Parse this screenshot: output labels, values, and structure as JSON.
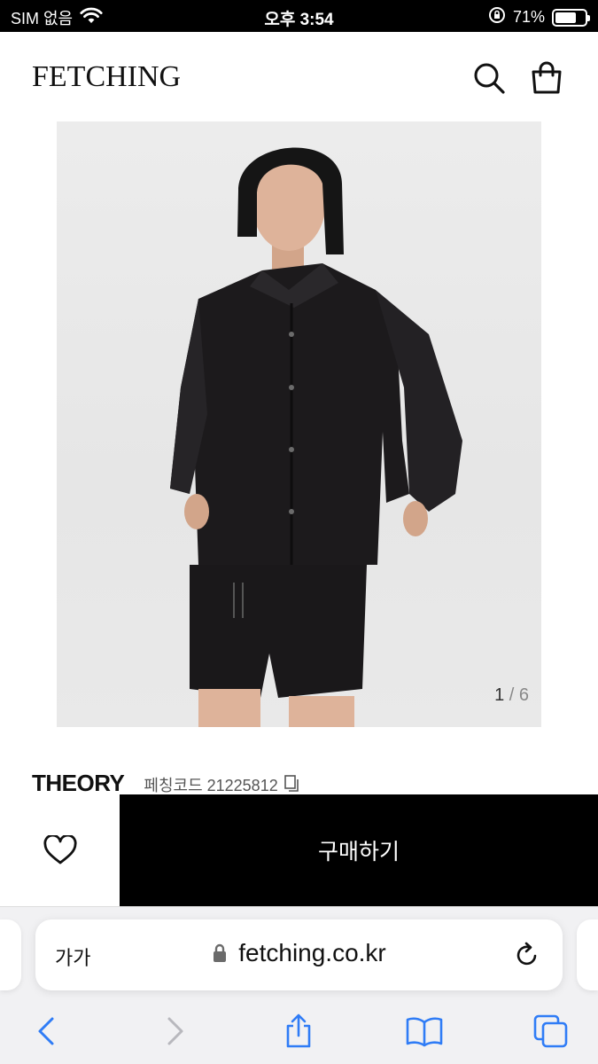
{
  "status_bar": {
    "carrier": "SIM 없음",
    "time": "오후 3:54",
    "battery_percent": "71%",
    "battery_level": 0.71
  },
  "header": {
    "logo": "FETCHING"
  },
  "product": {
    "image_counter_current": "1",
    "image_counter_separator": "/",
    "image_counter_total": "6",
    "brand": "THEORY",
    "code_label": "페칭코드 21225812"
  },
  "buy_bar": {
    "buy_label": "구매하기"
  },
  "browser": {
    "text_size_label": "가가",
    "url": "fetching.co.kr"
  },
  "icons": {
    "search": "search-icon",
    "bag": "shopping-bag-icon",
    "heart": "heart-icon",
    "copy": "copy-icon",
    "lock": "lock-icon",
    "reload": "reload-icon",
    "back": "back-arrow-icon",
    "forward": "forward-arrow-icon",
    "share": "share-icon",
    "bookmarks": "bookmarks-icon",
    "tabs": "tabs-icon"
  },
  "colors": {
    "buy_button": "#000000",
    "accent_blue": "#2f7cf6"
  }
}
